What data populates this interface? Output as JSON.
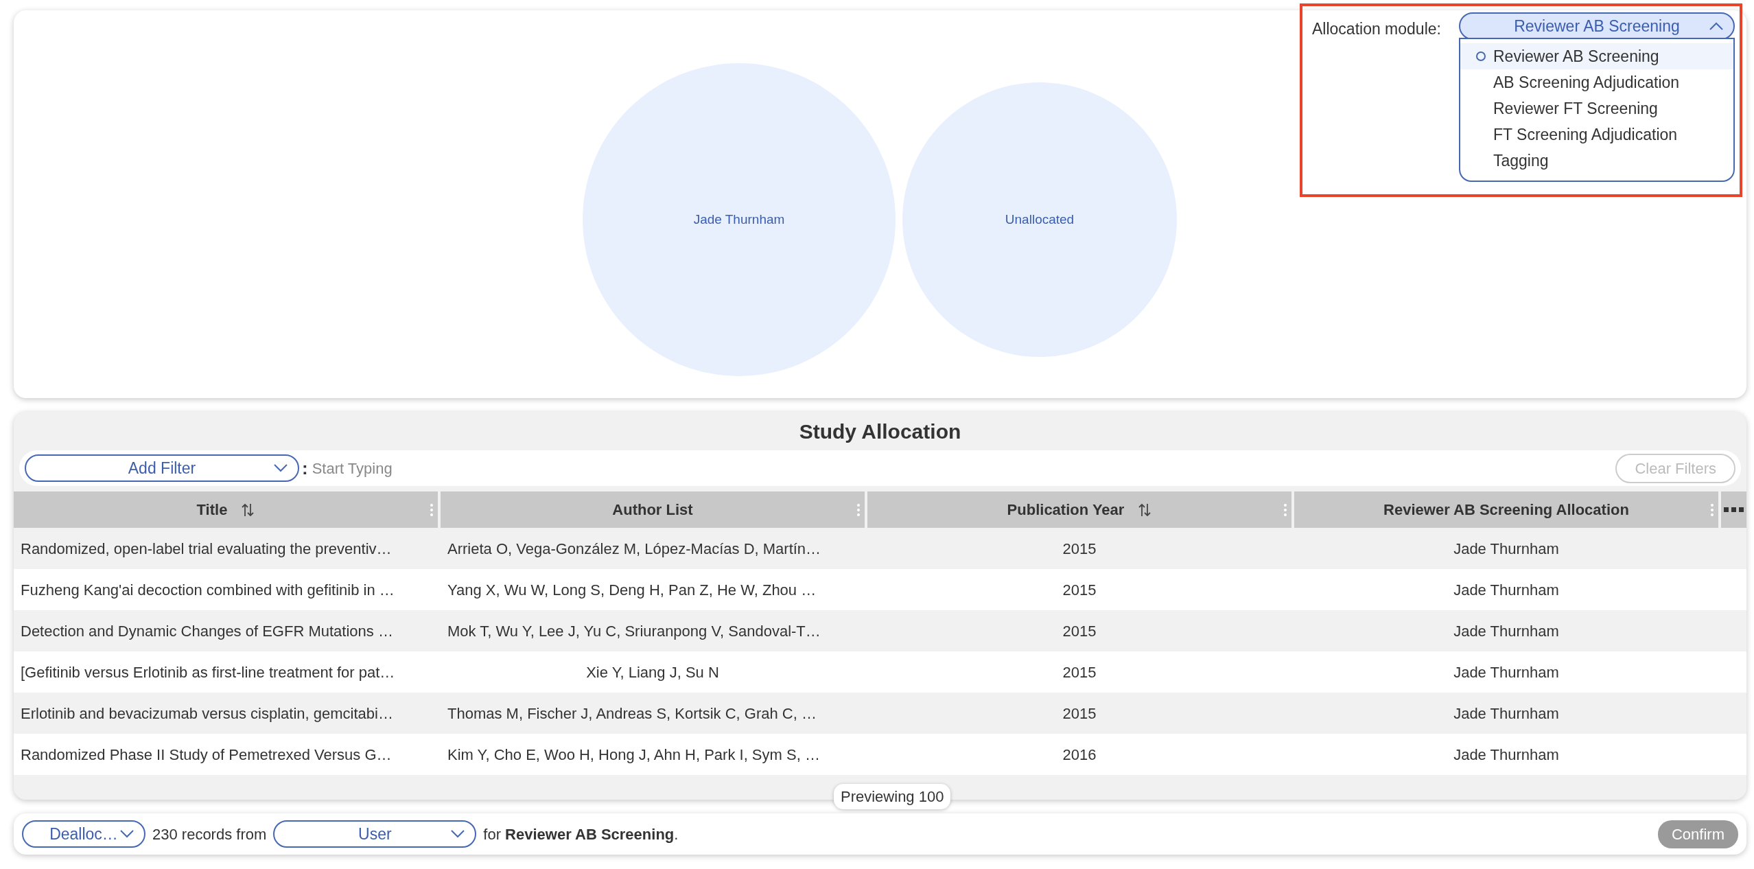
{
  "overview": {
    "bubbles": [
      {
        "label": "Jade Thurnham"
      },
      {
        "label": "Unallocated"
      }
    ]
  },
  "allocation_module": {
    "label": "Allocation module:",
    "value": "Reviewer AB Screening",
    "expanded": true,
    "options": [
      {
        "label": "Reviewer AB Screening",
        "selected": true
      },
      {
        "label": "AB Screening Adjudication",
        "selected": false
      },
      {
        "label": "Reviewer FT Screening",
        "selected": false
      },
      {
        "label": "FT Screening Adjudication",
        "selected": false
      },
      {
        "label": "Tagging",
        "selected": false
      }
    ]
  },
  "study_allocation": {
    "title": "Study Allocation",
    "filter": {
      "value": "Add Filter",
      "separator": ":",
      "placeholder": "Start Typing"
    },
    "clear_filters": {
      "label": "Clear Filters",
      "disabled": true
    },
    "columns": [
      {
        "label": "Title",
        "sortable": true
      },
      {
        "label": "Author List",
        "sortable": false
      },
      {
        "label": "Publication Year",
        "sortable": true
      },
      {
        "label": "Reviewer AB Screening Allocation",
        "sortable": false
      }
    ],
    "rows": [
      [
        "Randomized, open-label trial evaluating the preventiv…",
        "Arrieta O, Vega-González M, López-Macías D, Martín…",
        "2015",
        "Jade Thurnham"
      ],
      [
        "Fuzheng Kang'ai decoction combined with gefitinib in …",
        "Yang X, Wu W, Long S, Deng H, Pan Z, He W, Zhou …",
        "2015",
        "Jade Thurnham"
      ],
      [
        "Detection and Dynamic Changes of EGFR Mutations …",
        "Mok T, Wu Y, Lee J, Yu C, Sriuranpong V, Sandoval-T…",
        "2015",
        "Jade Thurnham"
      ],
      [
        "[Gefitinib versus Erlotinib as first-line treatment for pat…",
        "Xie Y, Liang J, Su N",
        "2015",
        "Jade Thurnham"
      ],
      [
        "Erlotinib and bevacizumab versus cisplatin, gemcitabi…",
        "Thomas M, Fischer J, Andreas S, Kortsik C, Grah C, …",
        "2015",
        "Jade Thurnham"
      ],
      [
        "Randomized Phase II Study of Pemetrexed Versus G…",
        "Kim Y, Cho E, Woo H, Hong J, Ahn H, Park I, Sym S, …",
        "2016",
        "Jade Thurnham"
      ]
    ],
    "preview": "Previewing 100"
  },
  "footer": {
    "action": "Dealloc…",
    "count_text": "230 records from",
    "source": "User",
    "summary": "for **Reviewer AB Screening**.",
    "confirm": {
      "label": "Confirm",
      "disabled": true
    }
  }
}
